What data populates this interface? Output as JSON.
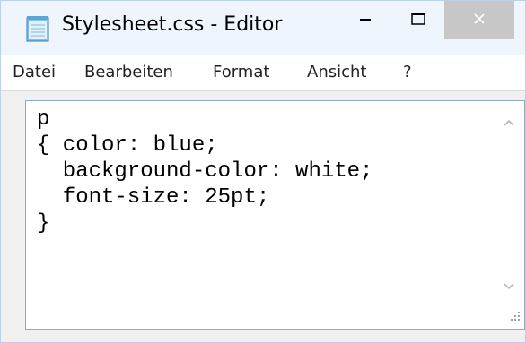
{
  "window": {
    "title": "Stylesheet.css - Editor"
  },
  "icons": {
    "app": "notepad-icon",
    "minimize": "minimize-icon",
    "maximize": "maximize-icon",
    "close": "close-icon",
    "scroll_up": "chevron-up-icon",
    "scroll_down": "chevron-down-icon",
    "resize": "resize-grip-icon"
  },
  "menu": {
    "items": [
      "Datei",
      "Bearbeiten",
      "Format",
      "Ansicht",
      "?"
    ]
  },
  "editor": {
    "lines": [
      "p",
      "{ color: blue;",
      "  background-color: white;",
      "  font-size: 25pt;",
      "}"
    ]
  },
  "colors": {
    "titlebar_bg": "#eef5fc",
    "close_button_bg": "#c7c7c7",
    "window_border": "#b9d1ea"
  }
}
